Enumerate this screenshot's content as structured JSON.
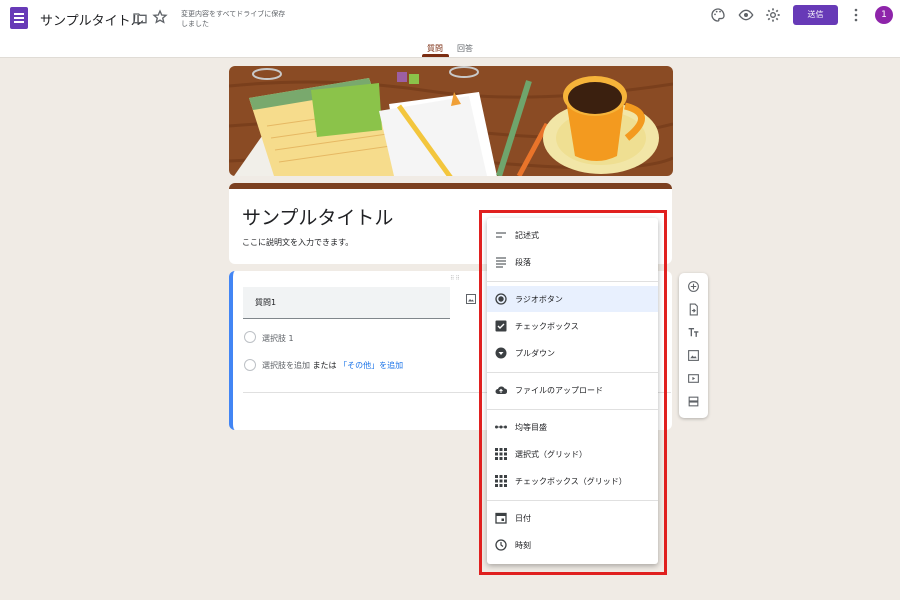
{
  "header": {
    "doc_title": "サンプルタイトル",
    "saved_status": "変更内容をすべてドライブに保存しました",
    "send_label": "送信",
    "avatar_initial": "1",
    "icons": [
      "palette-icon",
      "preview-icon",
      "settings-icon",
      "more-vert-icon"
    ]
  },
  "tabs": [
    {
      "label": "質問",
      "active": true
    },
    {
      "label": "回答",
      "active": false
    }
  ],
  "form": {
    "title": "サンプルタイトル",
    "description": "ここに説明文を入力できます。"
  },
  "question": {
    "title": "質問1",
    "options": [
      {
        "label": "選択肢 1"
      }
    ],
    "add_option": "選択肢を追加",
    "or_text": "または",
    "add_other": "「その他」を追加"
  },
  "question_types": [
    {
      "label": "記述式",
      "icon": "short-answer-icon"
    },
    {
      "label": "段落",
      "icon": "paragraph-icon"
    },
    {
      "label": "ラジオボタン",
      "icon": "radio-button-icon",
      "selected": true
    },
    {
      "label": "チェックボックス",
      "icon": "checkbox-icon"
    },
    {
      "label": "プルダウン",
      "icon": "dropdown-icon"
    },
    {
      "label": "ファイルのアップロード",
      "icon": "cloud-upload-icon"
    },
    {
      "label": "均等目盛",
      "icon": "linear-scale-icon"
    },
    {
      "label": "選択式（グリッド）",
      "icon": "grid-icon"
    },
    {
      "label": "チェックボックス（グリッド）",
      "icon": "checkbox-grid-icon"
    },
    {
      "label": "日付",
      "icon": "date-icon"
    },
    {
      "label": "時刻",
      "icon": "time-icon"
    }
  ],
  "toolbar": [
    "add-question-icon",
    "import-questions-icon",
    "add-title-icon",
    "add-image-icon",
    "add-video-icon",
    "add-section-icon"
  ],
  "colors": {
    "theme": "#673ab7",
    "header_accent": "#7b3f1f",
    "question_accent": "#4285f4",
    "highlight": "#e0201f"
  }
}
